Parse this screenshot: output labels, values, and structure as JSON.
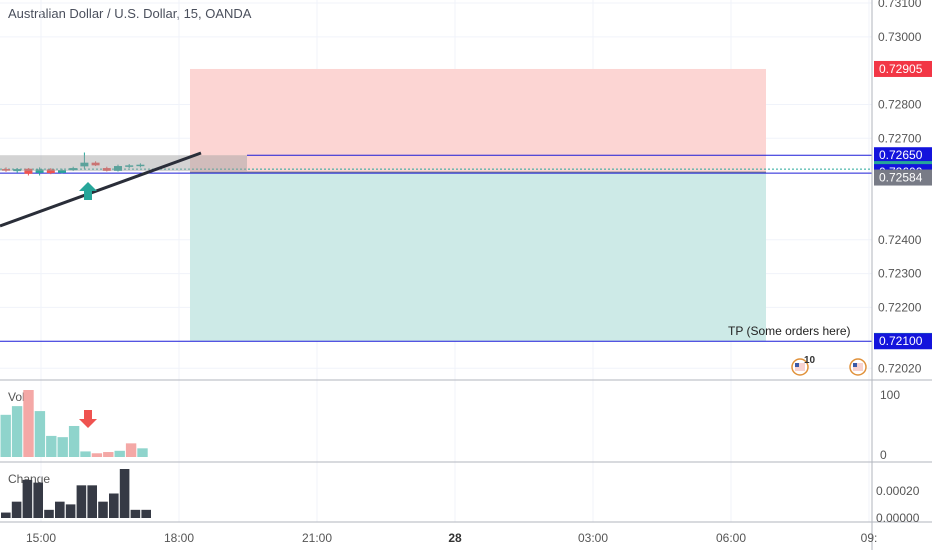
{
  "header": {
    "title": "Australian Dollar / U.S. Dollar, 15, OANDA"
  },
  "panes": {
    "volume_label": "Vol",
    "change_label": "Change"
  },
  "colors": {
    "up": "#26a69a",
    "down": "#ef5350",
    "up_vol": "#8fd4cc",
    "down_vol": "#f4a8a6",
    "stop_zone": "#fcd5d3",
    "target_zone": "#cdeae7",
    "line_blue": "#1c1cd8",
    "badge_blue": "#1414dc",
    "badge_red": "#f23645",
    "badge_green": "#26a69a",
    "badge_gray": "#787b86",
    "change_bar": "#363a45"
  },
  "chart_data": {
    "type": "candlestick",
    "symbol": "AUDUSD",
    "interval": "15",
    "price_axis": {
      "range": [
        0.72015,
        0.731
      ],
      "ticks": [
        "0.73100",
        "0.73000",
        "0.72800",
        "0.72700",
        "0.72400",
        "0.72300",
        "0.72200",
        "0.72020"
      ]
    },
    "time_axis": {
      "ticks": [
        "15:00",
        "18:00",
        "21:00",
        "28",
        "03:00",
        "06:00",
        "09:"
      ]
    },
    "candles": [
      {
        "t": 0,
        "o": 0.72609,
        "h": 0.72614,
        "l": 0.72601,
        "c": 0.72606
      },
      {
        "t": 1,
        "o": 0.72603,
        "h": 0.72612,
        "l": 0.72598,
        "c": 0.72609
      },
      {
        "t": 2,
        "o": 0.7261,
        "h": 0.72612,
        "l": 0.7259,
        "c": 0.72595
      },
      {
        "t": 3,
        "o": 0.72598,
        "h": 0.72614,
        "l": 0.7259,
        "c": 0.72608
      },
      {
        "t": 4,
        "o": 0.72608,
        "h": 0.72612,
        "l": 0.72594,
        "c": 0.72597
      },
      {
        "t": 5,
        "o": 0.72598,
        "h": 0.7261,
        "l": 0.72596,
        "c": 0.72606
      },
      {
        "t": 6,
        "o": 0.72606,
        "h": 0.72616,
        "l": 0.72604,
        "c": 0.72612
      },
      {
        "t": 7,
        "o": 0.72617,
        "h": 0.72658,
        "l": 0.7261,
        "c": 0.72628
      },
      {
        "t": 8,
        "o": 0.72628,
        "h": 0.72632,
        "l": 0.72618,
        "c": 0.7262
      },
      {
        "t": 9,
        "o": 0.72612,
        "h": 0.72616,
        "l": 0.72602,
        "c": 0.72604
      },
      {
        "t": 10,
        "o": 0.72604,
        "h": 0.72622,
        "l": 0.72602,
        "c": 0.72618
      },
      {
        "t": 11,
        "o": 0.72618,
        "h": 0.72624,
        "l": 0.72612,
        "c": 0.7262
      },
      {
        "t": 12,
        "o": 0.7262,
        "h": 0.72626,
        "l": 0.72614,
        "c": 0.72622
      }
    ],
    "volume": {
      "label": "Vol",
      "axis_ticks": [
        "100",
        "0"
      ],
      "values": [
        68,
        82,
        108,
        74,
        34,
        32,
        50,
        9,
        6,
        8,
        10,
        22,
        14
      ],
      "directions": [
        "up",
        "up",
        "down",
        "up",
        "up",
        "up",
        "up",
        "up",
        "down",
        "down",
        "up",
        "down",
        "up"
      ]
    },
    "change": {
      "label": "Change",
      "axis_ticks": [
        "0.00020",
        "0.00000"
      ],
      "values": [
        4e-05,
        0.00012,
        0.00028,
        0.00026,
        6e-05,
        0.00012,
        0.0001,
        0.00024,
        0.00024,
        0.00012,
        0.00018,
        0.00036,
        6e-05,
        6e-05
      ]
    },
    "position": {
      "type": "short",
      "entry": 0.726,
      "stop": 0.72905,
      "target": 0.72101,
      "target_label": "TP (Some orders here)"
    },
    "levels": {
      "resistance": 0.7265,
      "support_line": 0.721,
      "last_price": 0.72609,
      "bid": 0.72584
    },
    "price_badges": [
      {
        "value": "0.72905",
        "color_key": "badge_red"
      },
      {
        "value": "0.72650",
        "color_key": "badge_blue"
      },
      {
        "value": "0.72609",
        "color_key": "badge_green"
      },
      {
        "value": "0.72600",
        "color_key": "badge_blue"
      },
      {
        "value": "0.72584",
        "color_key": "badge_gray"
      },
      {
        "value": "0.72101",
        "color_key": "badge_green"
      },
      {
        "value": "0.72100",
        "color_key": "badge_blue"
      }
    ],
    "events": [
      {
        "label": "10",
        "icon": "flag-us-icon"
      },
      {
        "label": "",
        "icon": "flag-us-icon"
      }
    ]
  }
}
